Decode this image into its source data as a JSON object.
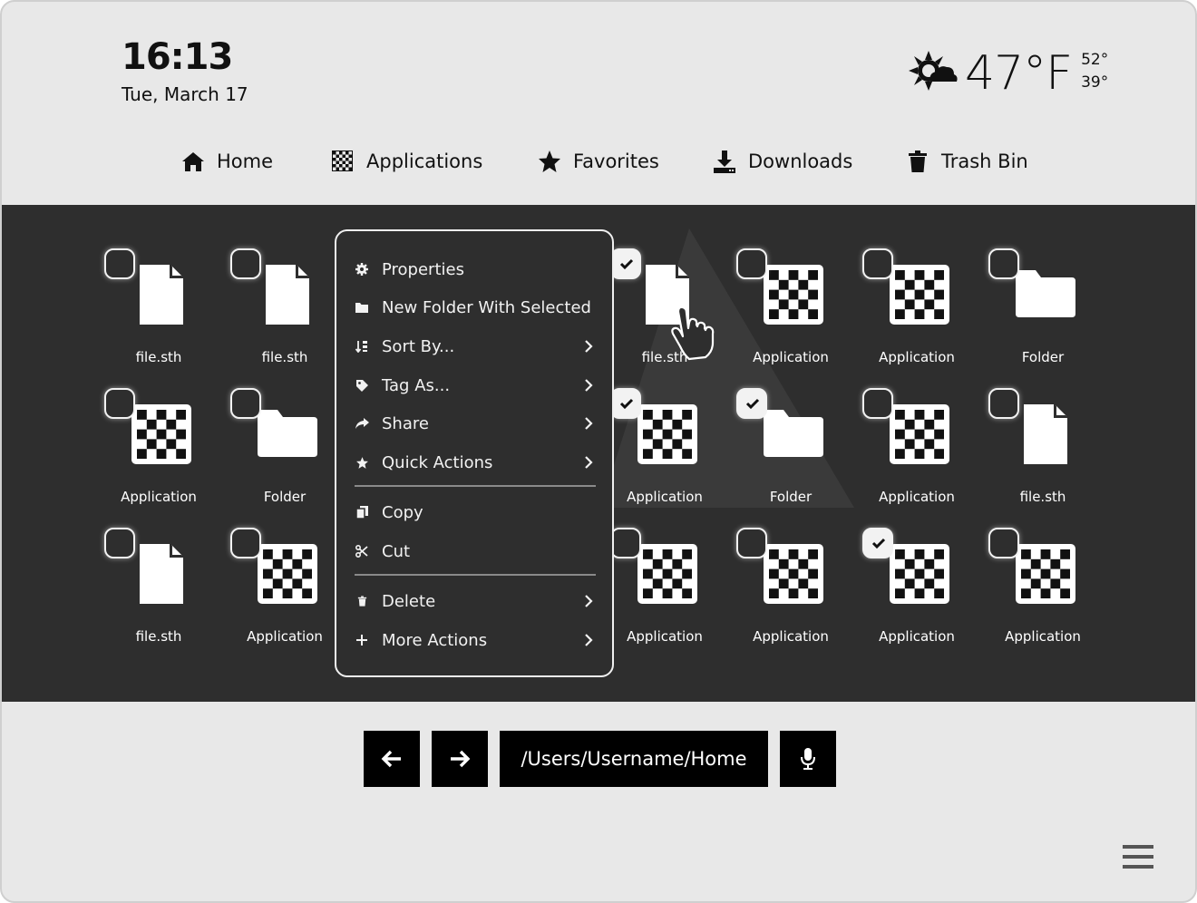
{
  "header": {
    "time": "16:13",
    "date": "Tue, March 17",
    "weather": {
      "icon": "sun-cloud-icon",
      "temp": "47°F",
      "high": "52°",
      "low": "39°"
    }
  },
  "nav": [
    {
      "label": "Home",
      "icon": "home-icon"
    },
    {
      "label": "Applications",
      "icon": "applications-icon"
    },
    {
      "label": "Favorites",
      "icon": "star-icon"
    },
    {
      "label": "Downloads",
      "icon": "download-icon"
    },
    {
      "label": "Trash Bin",
      "icon": "trash-icon"
    }
  ],
  "files": [
    {
      "label": "file.sth",
      "type": "file",
      "selected": false
    },
    {
      "label": "file.sth",
      "type": "file",
      "selected": false
    },
    {
      "label": "file.sth",
      "type": "file",
      "selected": true
    },
    {
      "label": "Application",
      "type": "app",
      "selected": false
    },
    {
      "label": "Application",
      "type": "app",
      "selected": false
    },
    {
      "label": "Folder",
      "type": "folder",
      "selected": false
    },
    {
      "label": "Application",
      "type": "app",
      "selected": false
    },
    {
      "label": "Folder",
      "type": "folder",
      "selected": false
    },
    {
      "label": "Application",
      "type": "app",
      "selected": true
    },
    {
      "label": "Folder",
      "type": "folder",
      "selected": true
    },
    {
      "label": "Application",
      "type": "app",
      "selected": false
    },
    {
      "label": "file.sth",
      "type": "file",
      "selected": false
    },
    {
      "label": "file.sth",
      "type": "file",
      "selected": false
    },
    {
      "label": "Application",
      "type": "app",
      "selected": false
    },
    {
      "label": "Application",
      "type": "app",
      "selected": false
    },
    {
      "label": "Application",
      "type": "app",
      "selected": false
    },
    {
      "label": "Application",
      "type": "app",
      "selected": true
    },
    {
      "label": "Application",
      "type": "app",
      "selected": false
    }
  ],
  "context_menu": {
    "items": [
      {
        "label": "Properties",
        "icon": "gear-icon",
        "submenu": false
      },
      {
        "label": "New Folder With Selected",
        "icon": "folder-icon",
        "submenu": false
      },
      {
        "label": "Sort By...",
        "icon": "sort-icon",
        "submenu": true
      },
      {
        "label": "Tag As...",
        "icon": "tag-icon",
        "submenu": true
      },
      {
        "label": "Share",
        "icon": "share-icon",
        "submenu": true
      },
      {
        "label": "Quick Actions",
        "icon": "star-icon",
        "submenu": true
      },
      {
        "label": "Copy",
        "icon": "copy-icon",
        "submenu": false
      },
      {
        "label": "Cut",
        "icon": "scissors-icon",
        "submenu": false
      },
      {
        "label": "Delete",
        "icon": "trash-icon",
        "submenu": true
      },
      {
        "label": "More Actions",
        "icon": "plus-icon",
        "submenu": true
      }
    ]
  },
  "bottom_bar": {
    "path": "/Users/Username/Home",
    "back_icon": "arrow-left-icon",
    "forward_icon": "arrow-right-icon",
    "mic_icon": "microphone-icon",
    "menu_icon": "hamburger-icon"
  },
  "colors": {
    "panel": "#2e2e2e",
    "background": "#e8e8e8",
    "accent": "#000000"
  }
}
